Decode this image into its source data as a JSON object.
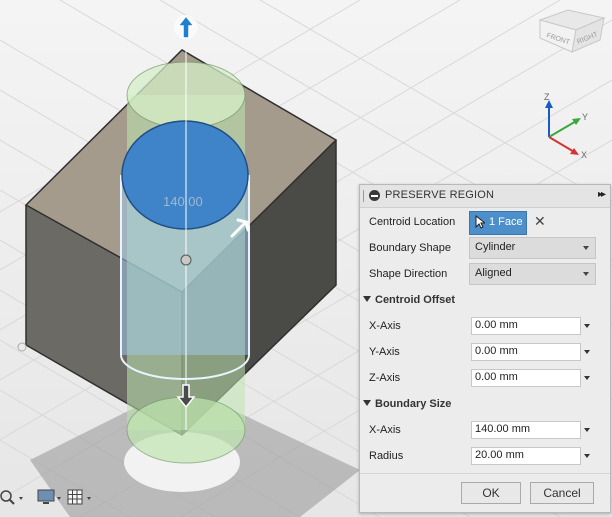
{
  "viewport": {
    "dimension_label": "140.00",
    "viewcube": {
      "front": "FRONT",
      "right": "RIGHT"
    },
    "triad": {
      "z": "Z",
      "y": "Y",
      "x": "X"
    }
  },
  "dialog": {
    "title": "PRESERVE REGION",
    "centroid_location": {
      "label": "Centroid Location",
      "value": "1 Face"
    },
    "boundary_shape": {
      "label": "Boundary Shape",
      "value": "Cylinder"
    },
    "shape_direction": {
      "label": "Shape Direction",
      "value": "Aligned"
    },
    "centroid_offset": {
      "title": "Centroid Offset",
      "x": {
        "label": "X-Axis",
        "value": "0.00 mm"
      },
      "y": {
        "label": "Y-Axis",
        "value": "0.00 mm"
      },
      "z": {
        "label": "Z-Axis",
        "value": "0.00 mm"
      }
    },
    "boundary_size": {
      "title": "Boundary Size",
      "x": {
        "label": "X-Axis",
        "value": "140.00 mm"
      },
      "radius": {
        "label": "Radius",
        "value": "20.00 mm"
      }
    },
    "ok_label": "OK",
    "cancel_label": "Cancel"
  },
  "colors": {
    "accent": "#4d8fcb",
    "region_green": "#a9d89a",
    "face_blue": "#3f83c9"
  },
  "toolbar": {
    "icons": [
      "zoom-icon",
      "display-settings-icon",
      "grid-icon"
    ]
  }
}
